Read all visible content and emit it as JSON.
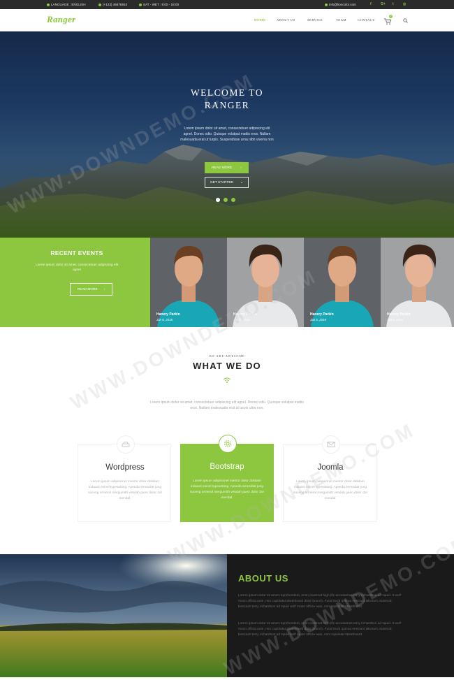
{
  "topbar": {
    "language": "LANGUAGE : ENGLISH",
    "phone": "(+123) 45678910",
    "hours": "SAT - WET : 9:00 - 18:00",
    "email": "info@lioncolor.com",
    "social": [
      "f",
      "G+",
      "t",
      "◎"
    ]
  },
  "header": {
    "logo": "Ranger",
    "nav": [
      "HOME",
      "ABOUT US",
      "SERVICE",
      "TEAM",
      "CONTACT"
    ],
    "cart_count": "0"
  },
  "hero": {
    "title_line1": "WELCOME TO",
    "title_line2": "RANGER",
    "text": "Lorem ipsum dolor sit amet, consectetuer adipiscing elit agnel. Donec odio. Quisque volutpat mattis eros. Nullam malesuada erat ut turpis. Suspendisse urna nibh viverra non",
    "read_more": "READ MORE",
    "get_started": "GET STARTED",
    "slide_count": "3"
  },
  "events": {
    "title": "RECENT EVENTS",
    "text": "Lorem ipsum dolor sit amet, consectetuer adipiscing elit agnel",
    "button": "READ MORE",
    "people": [
      {
        "name": "Hanery Parkin",
        "date": "Jan 6, 2016"
      },
      {
        "name": "Hanery Parkin",
        "date": "Jan 6, 2016"
      },
      {
        "name": "Hanery Parkin",
        "date": "Jan 6, 2016"
      },
      {
        "name": "Hanery Parkin",
        "date": "Jan 6, 2016"
      }
    ]
  },
  "what_we_do": {
    "subtitle": "WE ARE AWESOME",
    "title": "WHAT WE DO",
    "text": "Lorem ipsum dolor sit amet, consectetuer adipiscing elit agnel. Donec odio. Quisque volutpat mattis eros. Nullam malesuada erat ut turpis ultra non.",
    "cards": [
      {
        "title": "Wordpress",
        "text": "Lorem ipsum adipiscinel mentor dolor dolidam induant esinel typesetting. Apseda seresdiat jung suceng ormeral mergumith vetulah guen dolor dor mendal."
      },
      {
        "title": "Bootstrap",
        "text": "Lorem ipsum adipiscinel mentor dolor dolidam induant esinel typesetting. Apseda seresdiat jung suceng ormeral mergumith vetulah guen dolor dor mendal."
      },
      {
        "title": "Joomla",
        "text": "Lorem ipsum adipiscinel mentor dolor dolidam induant esinel typesetting. Apseda seresdiat jung suceng ormeral mergumith vetulah guen dolor dor mendal."
      }
    ]
  },
  "about": {
    "title": "ABOUT US",
    "para1": "Lorem ipsum dolor sit amet reprehenderit, enim eiusmod high life accusamus terry richardson ad squid. 3 wolf moon officia aute, non cupidatat skateboard dolor brunch. Food truck quinoa nesciunt laborum eiusmod. Nesciunt terry richardson ad squid wolf moon officia aute, non cupidatat skateboard.",
    "para2": "Lorem ipsum dolor sit amet reprehenderit, enim eiusmod high life accusamus terry richardson ad squid. 3 wolf moon officia aute, non cupidatat skateboard dolor brunch. Food truck quinoa nesciunt laborum eiusmod. Nesciunt terry richardson ad squid wolf moon officia aute, non cupidatat skateboard."
  },
  "watermark": "WWW.DOWNDEMO.COM",
  "colors": {
    "accent": "#8dc63f",
    "dark": "#2b2b2b",
    "footer": "#1a1a1a"
  }
}
